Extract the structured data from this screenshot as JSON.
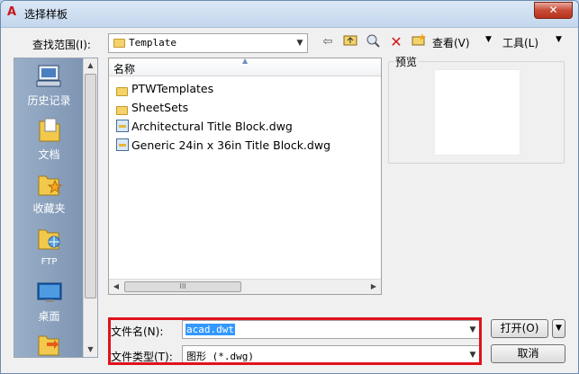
{
  "window": {
    "title": "选择样板",
    "close_glyph": "✕"
  },
  "toolbar": {
    "look_in_label": "查找范围(I):",
    "look_in_value": "Template",
    "views_label": "查看(V)",
    "tools_label": "工具(L)"
  },
  "places": [
    {
      "label": "历史记录",
      "icon": "history-icon"
    },
    {
      "label": "文档",
      "icon": "documents-icon"
    },
    {
      "label": "收藏夹",
      "icon": "favorites-icon"
    },
    {
      "label": "FTP",
      "icon": "ftp-icon"
    },
    {
      "label": "桌面",
      "icon": "desktop-icon"
    }
  ],
  "file_list": {
    "column_name": "名称",
    "items": [
      {
        "name": "PTWTemplates",
        "type": "folder"
      },
      {
        "name": "SheetSets",
        "type": "folder"
      },
      {
        "name": "Architectural Title Block.dwg",
        "type": "dwg"
      },
      {
        "name": "Generic 24in x 36in Title Block.dwg",
        "type": "dwg"
      }
    ]
  },
  "preview": {
    "label": "预览"
  },
  "filename": {
    "label": "文件名(N):",
    "value": "acad.dwt"
  },
  "filetype": {
    "label": "文件类型(T):",
    "value": "图形 (*.dwg)"
  },
  "buttons": {
    "open": "打开(O)",
    "cancel": "取消"
  },
  "colors": {
    "highlight": "#e0121b",
    "selection": "#3399ff",
    "places_bg": "#7d95b3"
  }
}
